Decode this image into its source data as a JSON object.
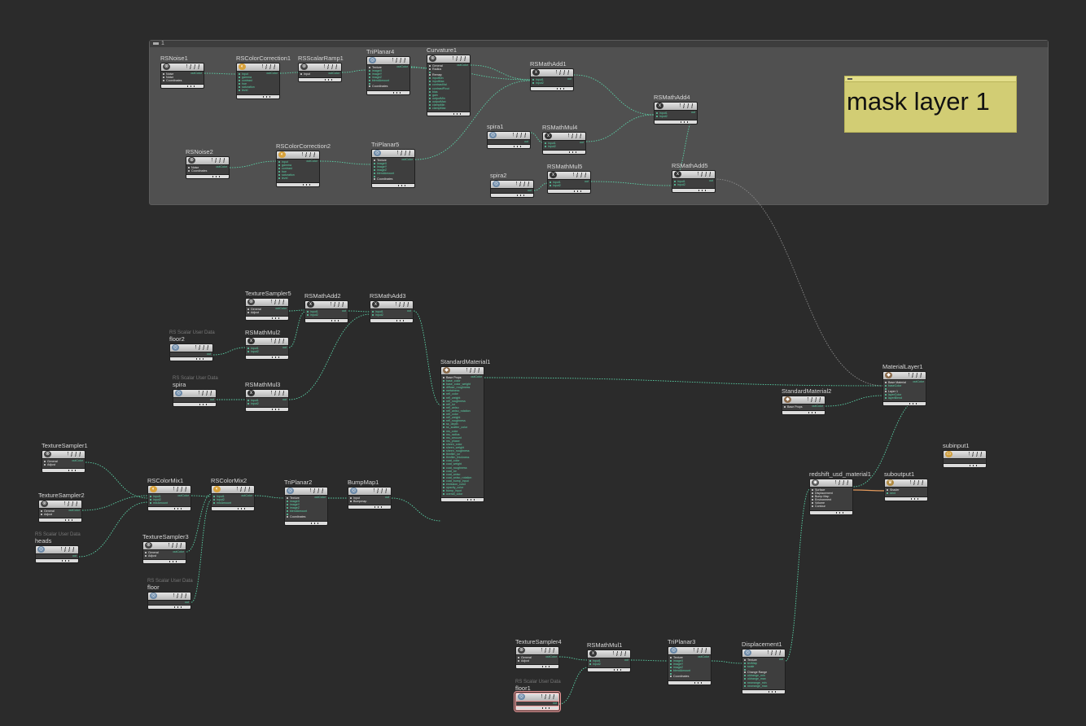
{
  "app": {
    "name": "Houdini Material Network"
  },
  "colors": {
    "background": "#2b2b2b",
    "wire": "#5bd3a8",
    "wire_grey": "#8a8a8a",
    "wire_orange": "#e49a5c",
    "sticky": "#d2cd74"
  },
  "network_box": {
    "title": "1"
  },
  "sticky_note": {
    "text": "mask layer 1"
  },
  "nodes": {
    "rsnoise1": {
      "name": "RSNoise1",
      "icon": "noise-icon",
      "out": "outColor",
      "ports": [
        "Noise",
        "Noise",
        "Coordinates"
      ]
    },
    "rscolorcorrection1": {
      "name": "RSColorCorrection1",
      "icon": "color-wheel-icon",
      "out": "outColor",
      "ports": [
        "input",
        "gamma",
        "contrast",
        "hue",
        "saturation",
        "level"
      ]
    },
    "rsscalarramp1": {
      "name": "RSScalarRamp1",
      "icon": "noise-icon",
      "out": "outColor",
      "ports": [
        "Input"
      ]
    },
    "triplanar4": {
      "name": "TriPlanar4",
      "icon": "globe-icon",
      "out": "outColor",
      "ports": [
        "Texture",
        "imageX",
        "imageY",
        "imageZ",
        "blendAmount",
        "",
        "Coordinates"
      ]
    },
    "curvature1": {
      "name": "Curvature1",
      "icon": "noise-icon",
      "out": "outColor",
      "ports": [
        "General",
        "Radius",
        "",
        "Remap",
        "inputMin",
        "inputMax",
        "contrastVal",
        "contrastPivot",
        "bias",
        "gain",
        "outputMin",
        "outputMax",
        "clampMin",
        "clampMax"
      ]
    },
    "rsmathadd1": {
      "name": "RSMathAdd1",
      "icon": "math-icon",
      "out": "out",
      "ports": [
        "input1",
        "input2"
      ]
    },
    "rsmathadd4": {
      "name": "RSMathAdd4",
      "icon": "math-icon",
      "out": "out",
      "ports": [
        "input1",
        "input2"
      ]
    },
    "spira1": {
      "name": "spira1",
      "icon": "globe-icon",
      "out": "out",
      "ports": []
    },
    "rsmathmul4": {
      "name": "RSMathMul4",
      "icon": "math-icon",
      "out": "out",
      "ports": [
        "input1",
        "input2"
      ]
    },
    "rsnoise2": {
      "name": "RSNoise2",
      "icon": "noise-icon",
      "out": "outColor",
      "ports": [
        "Noise",
        "Coordinates"
      ]
    },
    "rscolorcorrection2": {
      "name": "RSColorCorrection2",
      "icon": "color-wheel-icon",
      "out": "outColor",
      "ports": [
        "input",
        "gamma",
        "contrast",
        "hue",
        "saturation",
        "level"
      ]
    },
    "triplanar5": {
      "name": "TriPlanar5",
      "icon": "globe-icon",
      "out": "outColor",
      "ports": [
        "Texture",
        "imageX",
        "imageY",
        "imageZ",
        "blendAmount",
        "",
        "Coordinates"
      ]
    },
    "spira2": {
      "name": "spira2",
      "icon": "globe-icon",
      "out": "out",
      "ports": []
    },
    "rsmathmul5": {
      "name": "RSMathMul5",
      "icon": "math-icon",
      "out": "out",
      "ports": [
        "input1",
        "input2"
      ]
    },
    "rsmathadd5": {
      "name": "RSMathAdd5",
      "icon": "math-icon",
      "out": "out",
      "ports": [
        "input1",
        "input2"
      ]
    },
    "texturesampler5": {
      "name": "TextureSampler5",
      "icon": "noise-icon",
      "out": "outColor",
      "ports": [
        "General",
        "Adjust"
      ]
    },
    "rsmathadd2": {
      "name": "RSMathAdd2",
      "icon": "math-icon",
      "out": "out",
      "ports": [
        "input1",
        "input2"
      ]
    },
    "rsmathadd3": {
      "name": "RSMathAdd3",
      "icon": "math-icon",
      "out": "out",
      "ports": [
        "input1",
        "input2"
      ]
    },
    "floor2": {
      "name": "floor2",
      "sub": "RS Scalar User Data",
      "icon": "globe-icon",
      "out": "out",
      "ports": []
    },
    "rsmathmul2": {
      "name": "RSMathMul2",
      "icon": "math-icon",
      "out": "out",
      "ports": [
        "input1",
        "input2"
      ]
    },
    "spira": {
      "name": "spira",
      "sub": "RS Scalar User Data",
      "icon": "globe-icon",
      "out": "out",
      "ports": []
    },
    "rsmathmul3": {
      "name": "RSMathMul3",
      "icon": "math-icon",
      "out": "out",
      "ports": [
        "input1",
        "input2"
      ]
    },
    "standardmaterial1": {
      "name": "StandardMaterial1",
      "icon": "material-icon",
      "out": "outColor",
      "ports": [
        "Base Props",
        "base_color",
        "base_color_weight",
        "diffuse_roughness",
        "metalness",
        "refl_color",
        "refl_weight",
        "refl_roughness",
        "refl_ior",
        "refl_aniso",
        "refl_aniso_rotation",
        "refl_color",
        "refl_weight",
        "refl_roughness",
        "ss_depth",
        "ss_scatter_color",
        "ms_color",
        "ms_radius",
        "ms_amount",
        "ms_phase",
        "sheen_color",
        "sheen_weight",
        "sheen_roughness",
        "thinfilm_ior",
        "thinfilm_thickness",
        "coat_color",
        "coat_weight",
        "coat_roughness",
        "coat_ior",
        "coat_aniso",
        "coat_aniso_rotation",
        "coat_bump_input",
        "emission_color",
        "opacity_color",
        "bump_input",
        "overall_color"
      ]
    },
    "texturesampler1": {
      "name": "TextureSampler1",
      "icon": "noise-icon",
      "out": "outColor",
      "ports": [
        "General",
        "Adjust"
      ]
    },
    "texturesampler2": {
      "name": "TextureSampler2",
      "icon": "noise-icon",
      "out": "outColor",
      "ports": [
        "General",
        "Adjust"
      ]
    },
    "heads": {
      "name": "heads",
      "sub": "RS Scalar User Data",
      "icon": "globe-icon",
      "out": "out",
      "ports": []
    },
    "rscolormix1": {
      "name": "RSColorMix1",
      "icon": "color-wheel-icon",
      "out": "outColor",
      "ports": [
        "input1",
        "input2",
        "mixAmount"
      ]
    },
    "rscolormix2": {
      "name": "RSColorMix2",
      "icon": "color-wheel-icon",
      "out": "outColor",
      "ports": [
        "input1",
        "input2",
        "mixAmount"
      ]
    },
    "texturesampler3": {
      "name": "TextureSampler3",
      "icon": "noise-icon",
      "out": "outColor",
      "ports": [
        "General",
        "Adjust"
      ]
    },
    "floor": {
      "name": "floor",
      "sub": "RS Scalar User Data",
      "icon": "globe-icon",
      "out": "out",
      "ports": []
    },
    "triplanar2": {
      "name": "TriPlanar2",
      "icon": "globe-icon",
      "out": "outColor",
      "ports": [
        "Texture",
        "imageX",
        "imageY",
        "imageZ",
        "blendAmount",
        "",
        "Coordinates"
      ]
    },
    "bumpmap1": {
      "name": "BumpMap1",
      "icon": "globe-icon",
      "out": "out",
      "ports": [
        "Input",
        "Bumpmap"
      ]
    },
    "materiallayer1": {
      "name": "MaterialLayer1",
      "icon": "material-icon",
      "out": "outColor",
      "ports": [
        "Base Material",
        "baseColor",
        "",
        "Layer 1",
        "layerColor",
        "layerBlend"
      ]
    },
    "standardmaterial2": {
      "name": "StandardMaterial2",
      "icon": "material-icon",
      "out": "outColor",
      "ports": [
        "Base Props"
      ]
    },
    "subinput1": {
      "name": "subinput1",
      "icon": "folder-icon",
      "out": "",
      "ports": []
    },
    "redshift_usd_material1": {
      "name": "redshift_usd_material1",
      "icon": "redshift-icon",
      "out": "",
      "ports": [
        "Surface",
        "Displacement",
        "Bump Map",
        "Environment",
        "Volume",
        "Contour"
      ]
    },
    "suboutput1": {
      "name": "suboutput1",
      "icon": "trophy-icon",
      "out": "",
      "ports": [
        "Shader",
        "next"
      ]
    },
    "texturesampler4": {
      "name": "TextureSampler4",
      "icon": "noise-icon",
      "out": "outColor",
      "ports": [
        "General",
        "Adjust"
      ]
    },
    "floor1": {
      "name": "floor1",
      "sub": "RS Scalar User Data",
      "icon": "globe-icon",
      "out": "out",
      "ports": []
    },
    "rsmathmul1": {
      "name": "RSMathMul1",
      "icon": "math-icon",
      "out": "out",
      "ports": [
        "input1",
        "input2"
      ]
    },
    "triplanar3": {
      "name": "TriPlanar3",
      "icon": "globe-icon",
      "out": "outColor",
      "ports": [
        "Texture",
        "imageX",
        "imageY",
        "imageZ",
        "blendAmount",
        "",
        "Coordinates"
      ]
    },
    "displacement1": {
      "name": "Displacement1",
      "icon": "globe-icon",
      "out": "out",
      "ports": [
        "Texture",
        "texMap",
        "scale",
        "",
        "Change Range",
        "oldrange_min",
        "oldrange_max",
        "newrange_min",
        "newrange_max"
      ]
    }
  }
}
